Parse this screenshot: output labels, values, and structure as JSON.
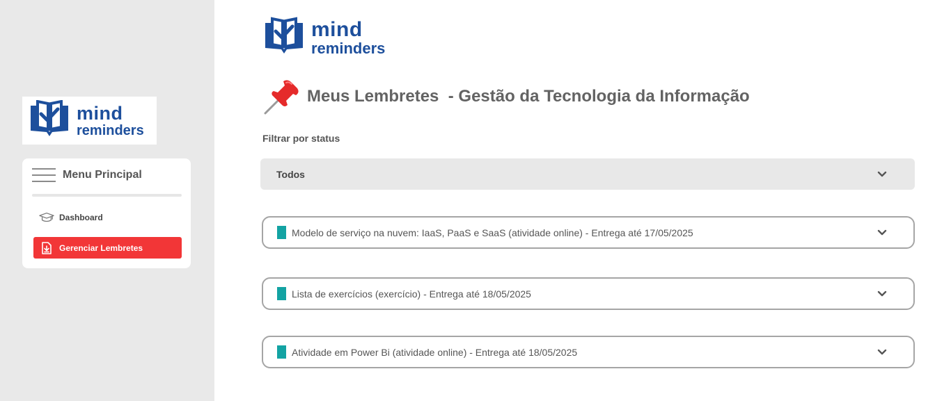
{
  "brand": {
    "line1": "mind",
    "line2": "reminders",
    "color": "#1d4f9c"
  },
  "sidebar": {
    "menu_title": "Menu Principal",
    "items": [
      {
        "label": "Dashboard",
        "icon": "graduation-cap-icon",
        "active": false
      },
      {
        "label": "Gerenciar Lembretes",
        "icon": "download-file-icon",
        "active": true
      }
    ],
    "active_color": "#f23637"
  },
  "main": {
    "title": "Meus Lembretes  - Gestão da Tecnologia da Informação",
    "title_icon": "pushpin-icon",
    "filter_label": "Filtrar por status",
    "filter_value": "Todos",
    "reminders": [
      {
        "text": "Modelo de serviço na nuvem: IaaS, PaaS e SaaS (atividade online) - Entrega até 17/05/2025"
      },
      {
        "text": "Lista de exercícios (exercício) - Entrega até 18/05/2025"
      },
      {
        "text": "Atividade em Power Bi (atividade online) - Entrega até 18/05/2025"
      }
    ],
    "tag_color": "#13a3a3"
  }
}
